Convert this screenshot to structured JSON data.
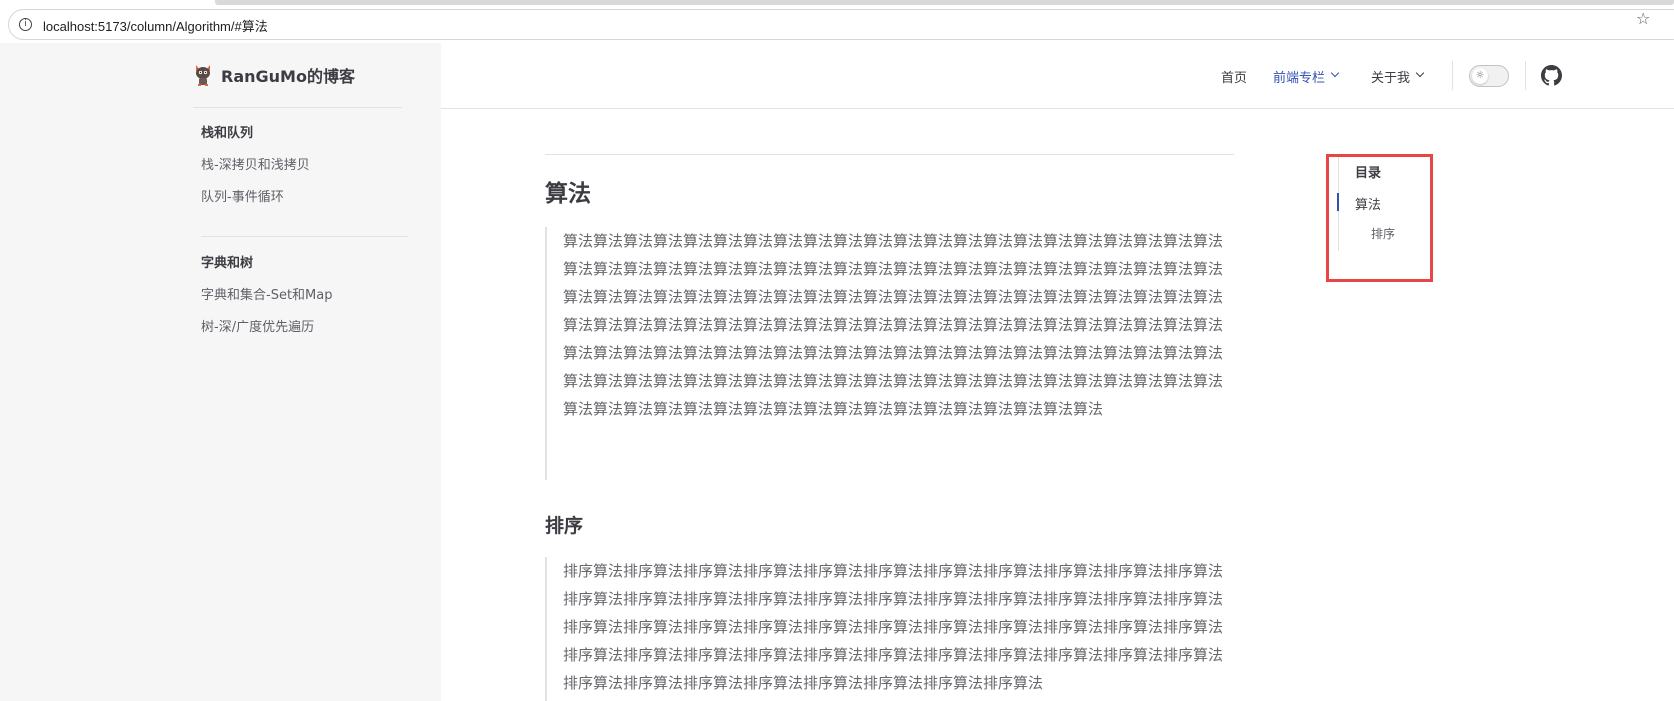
{
  "browser": {
    "url": "localhost:5173/column/Algorithm/#算法",
    "info_icon": "info-icon",
    "bookmark_icon": "star-icon"
  },
  "brand": {
    "title": "RanGuMo的博客",
    "logo_icon": "cat-logo-icon"
  },
  "sidebar": {
    "groups": [
      {
        "title": "栈和队列",
        "items": [
          "栈-深拷贝和浅拷贝",
          "队列-事件循环"
        ]
      },
      {
        "title": "字典和树",
        "items": [
          "字典和集合-Set和Map",
          "树-深/广度优先遍历"
        ]
      }
    ]
  },
  "nav": {
    "items": [
      {
        "label": "首页",
        "active": false,
        "dropdown": false
      },
      {
        "label": "前端专栏",
        "active": true,
        "dropdown": true
      },
      {
        "label": "关于我",
        "active": false,
        "dropdown": true
      }
    ],
    "theme_toggle_icon": "sun-icon",
    "github_icon": "github-icon"
  },
  "content": {
    "sections": [
      {
        "heading": "算法",
        "text": "算法算法算法算法算法算法算法算法算法算法算法算法算法算法算法算法算法算法算法算法算法算法算法算法算法算法算法算法算法算法算法算法算法算法算法算法算法算法算法算法算法算法算法算法算法算法算法算法算法算法算法算法算法算法算法算法算法算法算法算法算法算法算法算法算法算法算法算法算法算法算法算法算法算法算法算法算法算法算法算法算法算法算法算法算法算法算法算法算法算法算法算法算法算法算法算法算法算法算法算法算法算法算法算法算法算法算法算法算法算法算法算法算法算法算法算法算法算法算法算法算法算法算法算法算法算法算法算法算法算法算法算法算法算法算法算法算法算法算法算法算法算法算法算法算法算法算法算法算法算法"
      },
      {
        "heading": "排序",
        "text": "排序算法排序算法排序算法排序算法排序算法排序算法排序算法排序算法排序算法排序算法排序算法排序算法排序算法排序算法排序算法排序算法排序算法排序算法排序算法排序算法排序算法排序算法排序算法排序算法排序算法排序算法排序算法排序算法排序算法排序算法排序算法排序算法排序算法排序算法排序算法排序算法排序算法排序算法排序算法排序算法排序算法排序算法排序算法排序算法排序算法排序算法排序算法排序算法排序算法排序算法排序算法排序算法"
      }
    ]
  },
  "toc": {
    "title": "目录",
    "items": [
      {
        "label": "算法",
        "level": 1,
        "active": true
      },
      {
        "label": "排序",
        "level": 2,
        "active": false
      }
    ],
    "highlight_color": "#e94545",
    "accent_color": "#3451b2"
  }
}
